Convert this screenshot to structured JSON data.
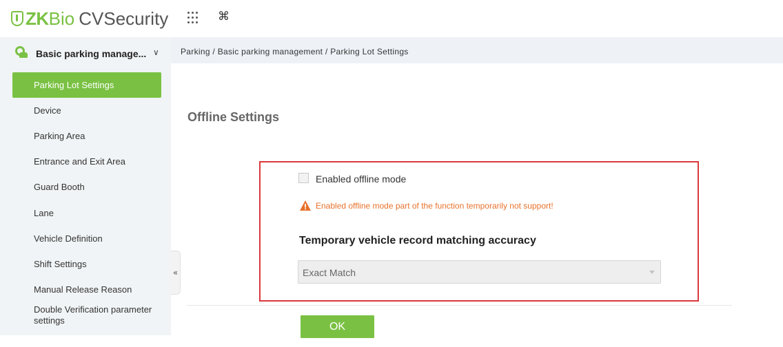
{
  "app": {
    "logo_zk": "ZK",
    "logo_bio": "Bio",
    "logo_product": "CVSecurity"
  },
  "toolbar": {
    "apps_icon": "grid-dots-icon",
    "cmd_icon": "command-key-icon",
    "cmd_glyph": "⌘"
  },
  "sidebar": {
    "module": {
      "label": "Basic parking manage...",
      "icon": "parking-gear-icon",
      "chevron": "∨"
    },
    "items": [
      {
        "label": "Parking Lot Settings",
        "active": true
      },
      {
        "label": "Device"
      },
      {
        "label": "Parking Area"
      },
      {
        "label": "Entrance and Exit Area"
      },
      {
        "label": "Guard Booth"
      },
      {
        "label": "Lane"
      },
      {
        "label": "Vehicle Definition"
      },
      {
        "label": "Shift Settings"
      },
      {
        "label": "Manual Release Reason"
      },
      {
        "label": "Double Verification parameter settings"
      }
    ],
    "collapse_glyph": "«"
  },
  "breadcrumb": "Parking / Basic parking management / Parking Lot Settings",
  "main": {
    "section_title": "Offline Settings",
    "offline_checkbox": {
      "label": "Enabled offline mode",
      "checked": false
    },
    "warning": {
      "text": "Enabled offline mode part of the function temporarily not support!",
      "icon": "warning-triangle-icon",
      "color": "#e8722c"
    },
    "accuracy_label": "Temporary vehicle record matching accuracy",
    "accuracy_select": {
      "value": "Exact Match"
    },
    "ok_label": "OK"
  },
  "colors": {
    "brand": "#7ac143",
    "highlight_border": "#d9383c",
    "breadcrumb_bg": "#eef2f7",
    "sidebar_bg": "#f1f4f6"
  }
}
